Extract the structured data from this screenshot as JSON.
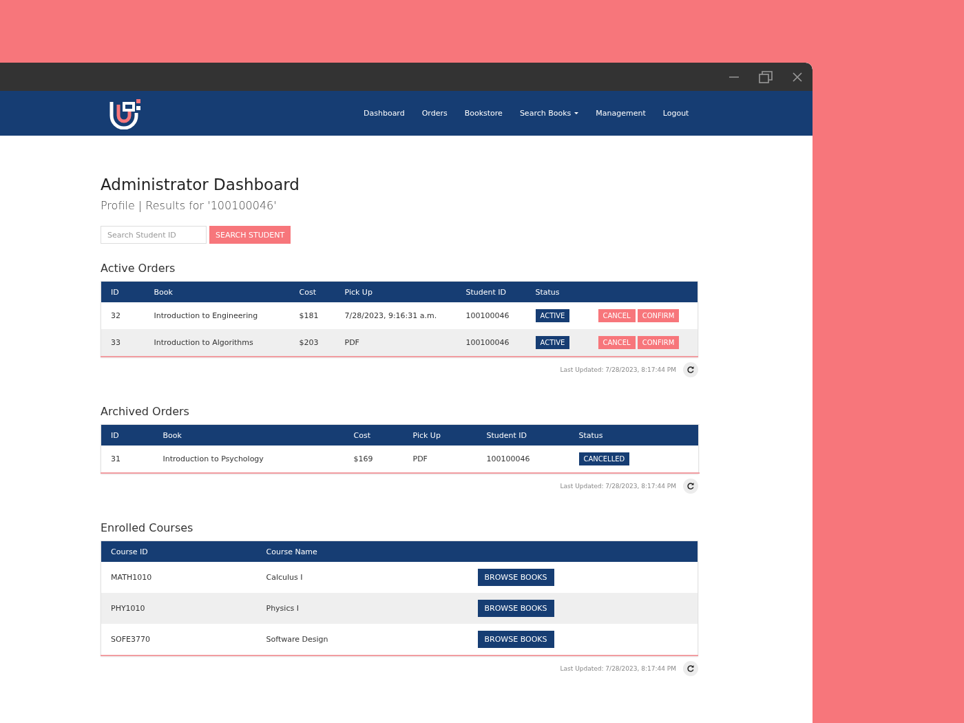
{
  "nav": {
    "items": [
      {
        "label": "Dashboard",
        "dropdown": false
      },
      {
        "label": "Orders",
        "dropdown": false
      },
      {
        "label": "Bookstore",
        "dropdown": false
      },
      {
        "label": "Search Books",
        "dropdown": true
      },
      {
        "label": "Management",
        "dropdown": false
      },
      {
        "label": "Logout",
        "dropdown": false
      }
    ]
  },
  "page": {
    "title": "Administrator Dashboard",
    "subtitle": "Profile | Results for '100100046'"
  },
  "search": {
    "placeholder": "Search Student ID",
    "button": "SEARCH STUDENT"
  },
  "active_orders": {
    "title": "Active Orders",
    "columns": [
      "ID",
      "Book",
      "Cost",
      "Pick Up",
      "Student ID",
      "Status"
    ],
    "rows": [
      {
        "cells": [
          "32",
          "Introduction to Engineering",
          "$181",
          "7/28/2023, 9:16:31 a.m.",
          "100100046"
        ],
        "status": "ACTIVE",
        "actions": [
          "CANCEL",
          "CONFIRM"
        ]
      },
      {
        "cells": [
          "33",
          "Introduction to Algorithms",
          "$203",
          "PDF",
          "100100046"
        ],
        "status": "ACTIVE",
        "actions": [
          "CANCEL",
          "CONFIRM"
        ]
      }
    ],
    "last_updated": "Last Updated: 7/28/2023, 8:17:44 PM"
  },
  "archived_orders": {
    "title": "Archived Orders",
    "columns": [
      "ID",
      "Book",
      "Cost",
      "Pick Up",
      "Student ID",
      "Status"
    ],
    "rows": [
      {
        "cells": [
          "31",
          "Introduction to Psychology",
          "$169",
          "PDF",
          "100100046"
        ],
        "status": "CANCELLED"
      }
    ],
    "last_updated": "Last Updated: 7/28/2023, 8:17:44 PM"
  },
  "enrolled_courses": {
    "title": "Enrolled Courses",
    "columns": [
      "Course ID",
      "Course Name"
    ],
    "rows": [
      {
        "cells": [
          "MATH1010",
          "Calculus I"
        ],
        "button": "BROWSE BOOKS"
      },
      {
        "cells": [
          "PHY1010",
          "Physics I"
        ],
        "button": "BROWSE BOOKS"
      },
      {
        "cells": [
          "SOFE3770",
          "Software Design"
        ],
        "button": "BROWSE BOOKS"
      }
    ],
    "last_updated": "Last Updated: 7/28/2023, 8:17:44 PM"
  }
}
